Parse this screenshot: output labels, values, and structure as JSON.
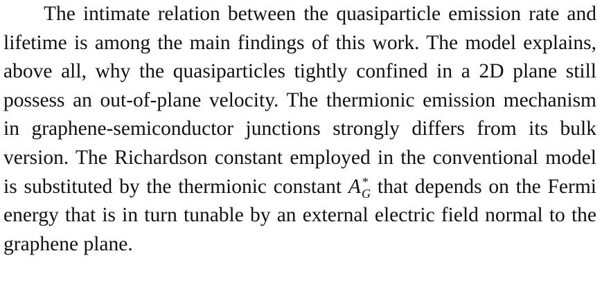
{
  "paragraph": {
    "part1": "The intimate relation between the quasiparticle emission rate and lifetime is among the main findings of this work. The model explains, above all, why the quasiparticles tightly con­fined in a 2D plane still possess an out-of-plane velocity. The thermionic emission mechanism in graphene-semiconductor junctions strongly differs from its bulk version. The Richardson constant employed in the conventional model is substituted by the thermionic constant ",
    "math": {
      "base": "A",
      "superscript": "*",
      "subscript": "G"
    },
    "part2": " that depends on the Fermi energy that is in turn tunable by an external electric field normal to the graphene plane."
  }
}
